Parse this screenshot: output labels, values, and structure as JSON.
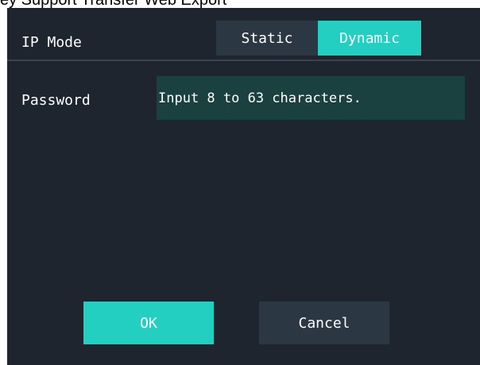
{
  "top_strip": {
    "text": "ey Support Transfer Web Export"
  },
  "ip_mode": {
    "label": "IP Mode",
    "options": [
      "Static",
      "Dynamic"
    ],
    "selected": "Dynamic"
  },
  "password": {
    "label": "Password",
    "placeholder": "Input 8 to 63 characters."
  },
  "buttons": {
    "ok": "OK",
    "cancel": "Cancel"
  },
  "colors": {
    "panel_bg": "#1e252f",
    "accent": "#22cfc1",
    "segment_inactive": "#2c3744",
    "input_bg": "#1b4040",
    "divider": "#3a4350"
  }
}
